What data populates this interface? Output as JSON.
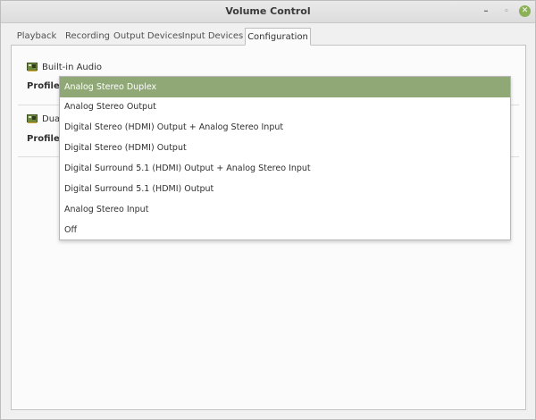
{
  "window": {
    "title": "Volume Control",
    "minimize_glyph": "–",
    "maximize_glyph": "◦",
    "close_glyph": "✕"
  },
  "tabs": [
    {
      "label": "Playback",
      "active": false
    },
    {
      "label": "Recording",
      "active": false
    },
    {
      "label": "Output Devices",
      "active": false
    },
    {
      "label": "Input Devices",
      "active": false
    },
    {
      "label": "Configuration",
      "active": true
    }
  ],
  "devices": [
    {
      "name": "Built-in Audio",
      "profile_label": "Profile:",
      "icon": "sound-card-icon"
    },
    {
      "name": "Dual",
      "profile_label": "Profile:",
      "icon": "sound-card-icon"
    }
  ],
  "profile_dropdown": {
    "selected": "Analog Stereo Duplex",
    "options": [
      "Analog Stereo Duplex",
      "Analog Stereo Output",
      "Digital Stereo (HDMI) Output + Analog Stereo Input",
      "Digital Stereo (HDMI) Output",
      "Digital Surround 5.1 (HDMI) Output + Analog Stereo Input",
      "Digital Surround 5.1 (HDMI) Output",
      "Analog Stereo Input",
      "Off"
    ]
  },
  "colors": {
    "accent": "#8fa876",
    "close_button": "#8bb158",
    "card_icon": "#6d8a3c"
  }
}
